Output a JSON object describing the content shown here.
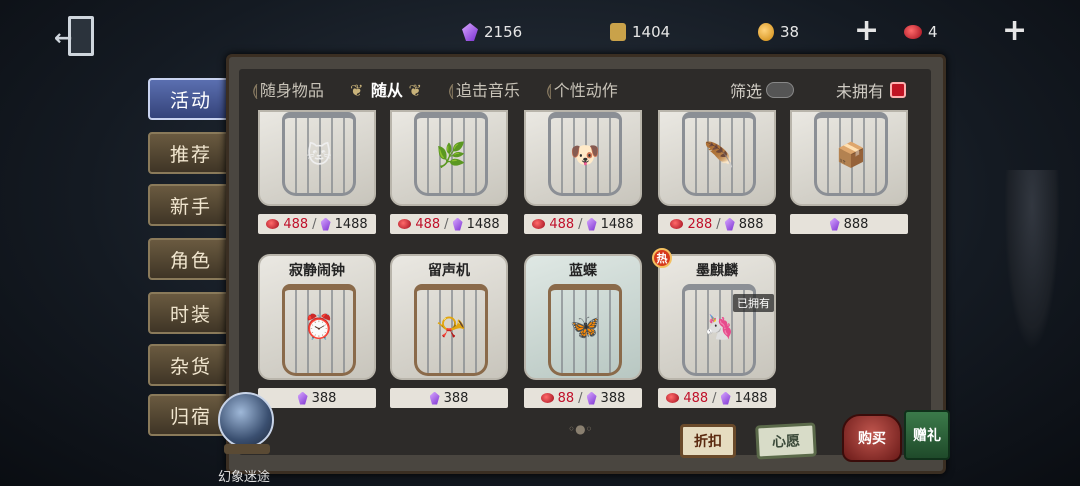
{
  "currencies": {
    "gems": "2156",
    "puzzles": "1404",
    "coins": "38",
    "red_gems": "4"
  },
  "left_tabs": [
    "活动",
    "推荐",
    "新手",
    "角色",
    "时装",
    "杂货",
    "归宿"
  ],
  "filter_tabs": [
    "随身物品",
    "随从",
    "追击音乐",
    "个性动作"
  ],
  "filter_label": "筛选",
  "owned_label": "未拥有",
  "items_row1": [
    {
      "red": "488",
      "gem": "1488",
      "pet": "🐱"
    },
    {
      "red": "488",
      "gem": "1488",
      "pet": "🌿"
    },
    {
      "red": "488",
      "gem": "1488",
      "pet": "🐶"
    },
    {
      "red": "288",
      "gem": "888",
      "pet": "🪶"
    },
    {
      "red": "",
      "gem": "888",
      "pet": "📦"
    }
  ],
  "items_row2": [
    {
      "name": "寂静闹钟",
      "red": "",
      "gem": "388",
      "pet": "⏰"
    },
    {
      "name": "留声机",
      "red": "",
      "gem": "388",
      "pet": "📯"
    },
    {
      "name": "蓝蝶",
      "red": "88",
      "gem": "388",
      "pet": "🦋"
    },
    {
      "name": "墨麒麟",
      "red": "488",
      "gem": "1488",
      "pet": "🦄",
      "hot": "热",
      "owned": "已拥有"
    }
  ],
  "actions": {
    "discount": "折扣",
    "wish": "心愿",
    "buy": "购买",
    "gift": "赠礼"
  },
  "globe_label": "幻象迷途",
  "colors": {
    "active_tab": "#34437a",
    "price_red": "#c0102a",
    "gem_purple": "#7a2fd0"
  }
}
